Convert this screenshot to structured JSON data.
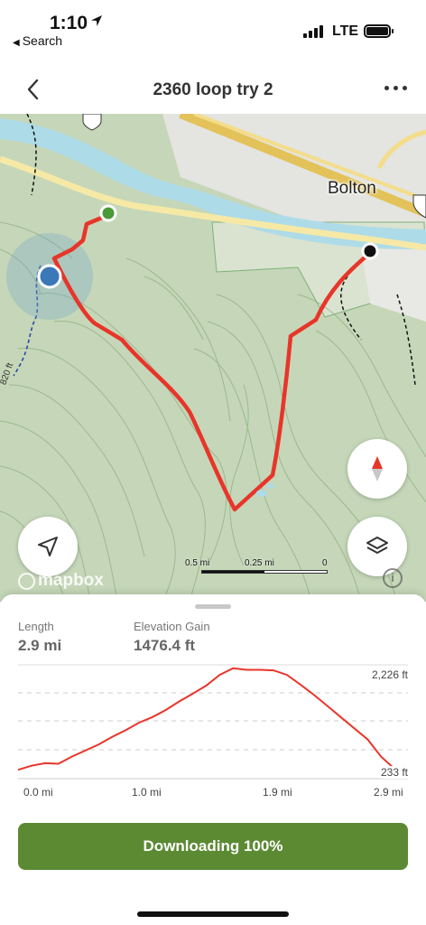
{
  "status_bar": {
    "time": "1:10",
    "back_label": "Search",
    "network": "LTE"
  },
  "nav": {
    "title": "2360 loop try 2",
    "back_icon": "chevron-left-icon",
    "more_icon": "more-horizontal-icon"
  },
  "map": {
    "place_label": "Bolton",
    "contour_label": "820 ft",
    "scale_labels": [
      "0.5 mi",
      "0.25 mi",
      "0"
    ],
    "attribution": "mapbox",
    "route_color": "#e8352a",
    "start_marker_color": "#4a9a3a",
    "end_marker_color": "#111111",
    "location_color": "#3a78b8",
    "buttons": [
      "compass-icon",
      "location-arrow-icon",
      "layers-icon"
    ]
  },
  "stats": {
    "length_label": "Length",
    "length_value": "2.9 mi",
    "gain_label": "Elevation Gain",
    "gain_value": "1476.4 ft"
  },
  "chart_data": {
    "type": "line",
    "title": "",
    "xlabel": "",
    "ylabel": "",
    "x_tick_labels": [
      "0.0 mi",
      "1.0 mi",
      "1.9 mi",
      "2.9 mi"
    ],
    "y_tick_labels": [
      "2,226 ft",
      "233 ft"
    ],
    "xlim": [
      0,
      2.9
    ],
    "ylim": [
      233,
      2226
    ],
    "series": [
      {
        "color": "#e8352a",
        "x": [
          0.0,
          0.1,
          0.2,
          0.3,
          0.4,
          0.5,
          0.6,
          0.7,
          0.8,
          0.9,
          1.0,
          1.1,
          1.2,
          1.3,
          1.4,
          1.5,
          1.6,
          1.7,
          1.8,
          1.9,
          2.0,
          2.1,
          2.2,
          2.3,
          2.4,
          2.5,
          2.6,
          2.7,
          2.8,
          2.9
        ],
        "y": [
          300,
          380,
          430,
          420,
          560,
          680,
          800,
          950,
          1080,
          1230,
          1340,
          1480,
          1650,
          1800,
          1960,
          2170,
          2300,
          2270,
          2270,
          2260,
          2170,
          1980,
          1780,
          1560,
          1340,
          1120,
          900,
          560,
          320,
          280
        ]
      }
    ]
  },
  "download": {
    "label": "Downloading 100%"
  }
}
